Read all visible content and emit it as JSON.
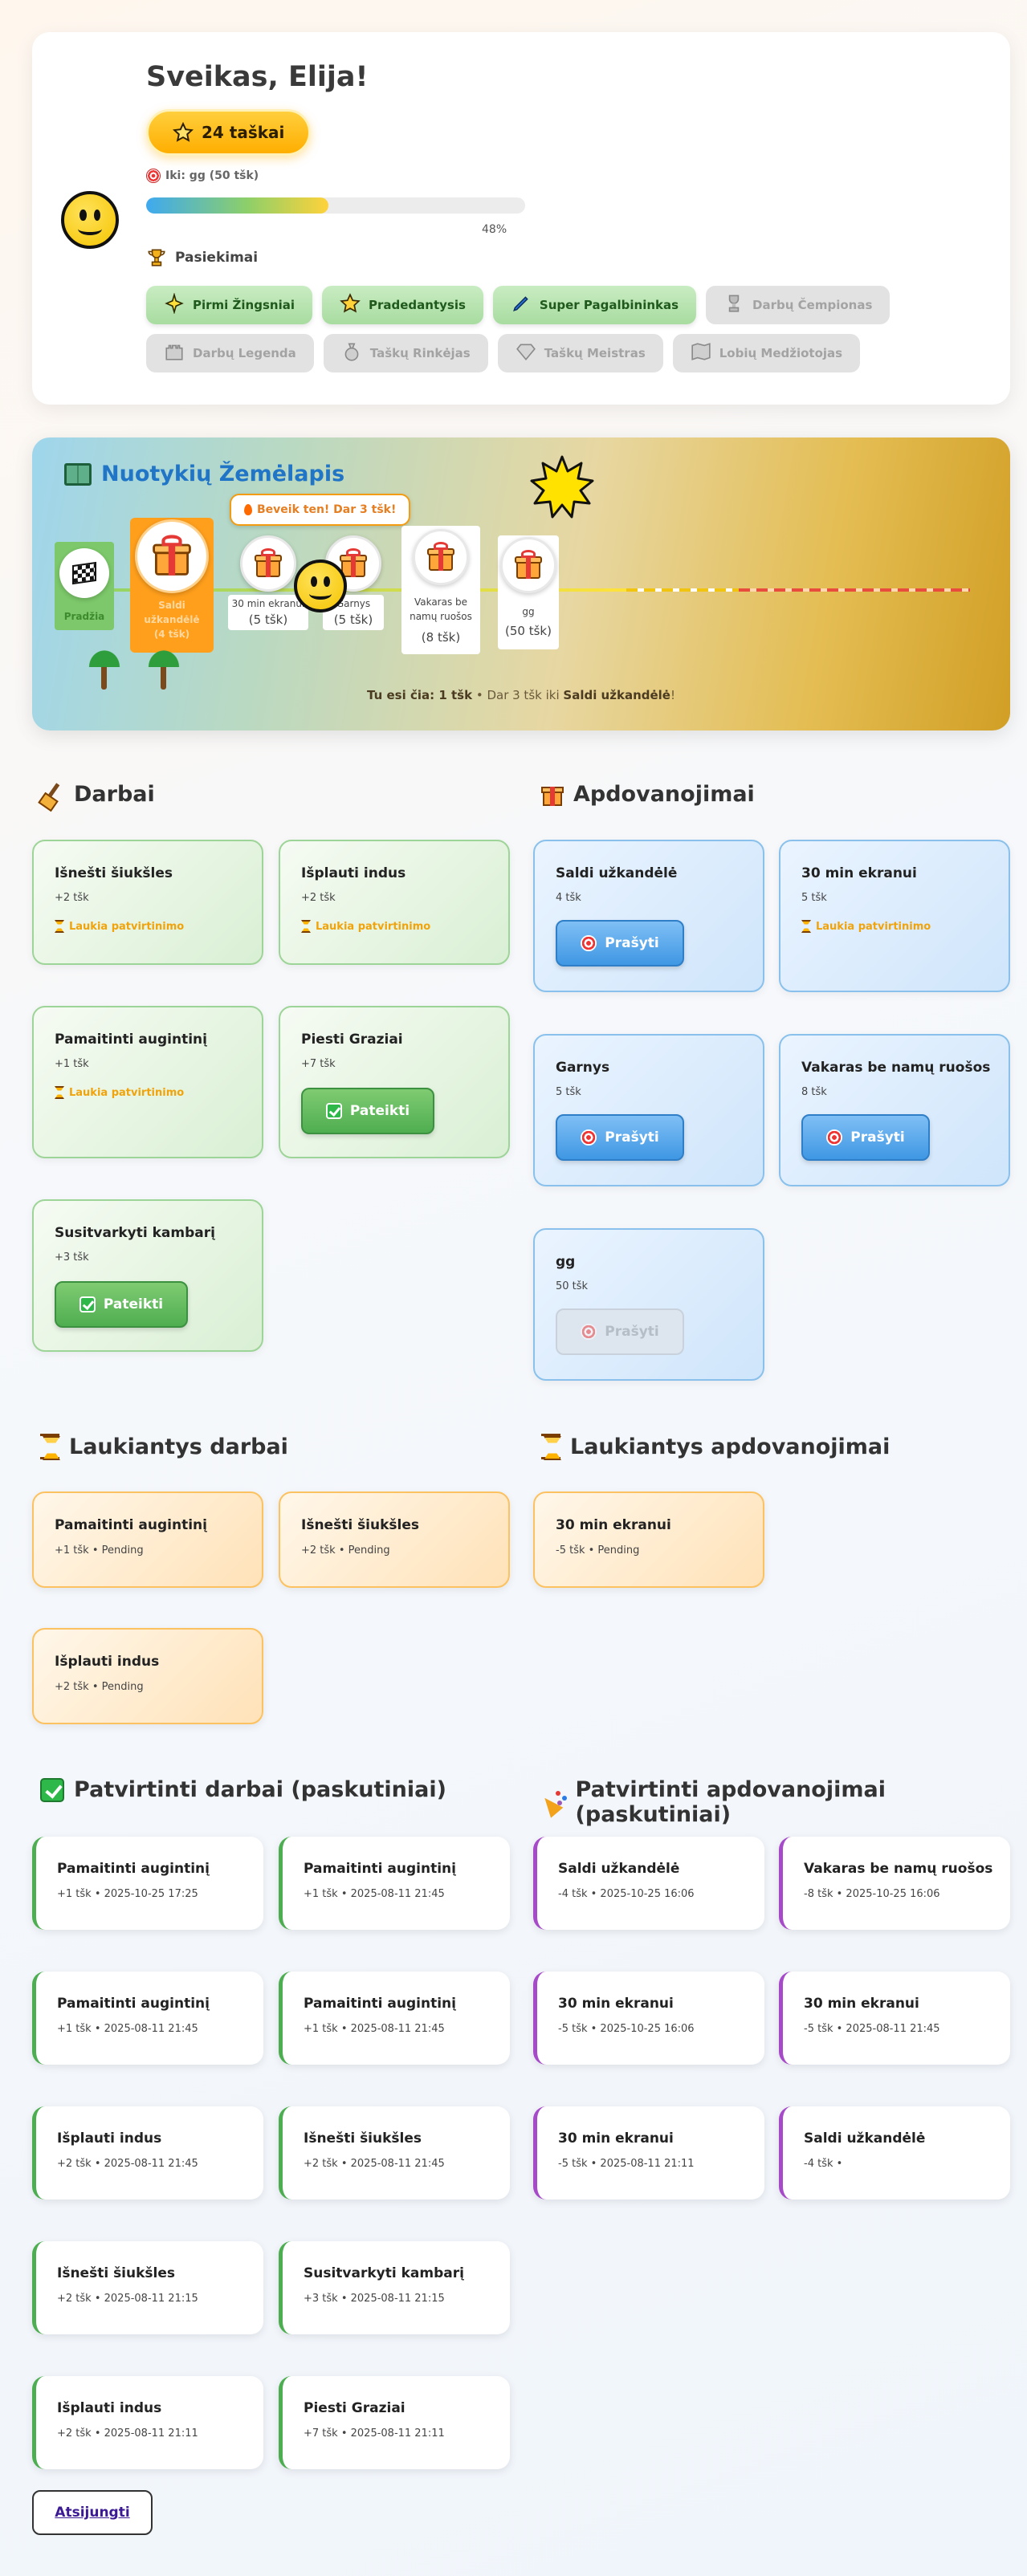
{
  "header": {
    "greeting": "Sveikas, Elija!",
    "points_label": "24 taškai",
    "goal_label": "Iki: gg (50 tšk)",
    "progress_percent": 48,
    "progress_label": "48%",
    "achievements_title": "Pasiekimai",
    "achievements": [
      {
        "label": "Pirmi Žingsniai",
        "unlocked": true,
        "icon": "sparkle-icon"
      },
      {
        "label": "Pradedantysis",
        "unlocked": true,
        "icon": "star-icon"
      },
      {
        "label": "Super Pagalbininkas",
        "unlocked": true,
        "icon": "brush-icon"
      },
      {
        "label": "Darbų Čempionas",
        "unlocked": false,
        "icon": "trophy-icon"
      },
      {
        "label": "Darbų Legenda",
        "unlocked": false,
        "icon": "castle-icon"
      },
      {
        "label": "Taškų Rinkėjas",
        "unlocked": false,
        "icon": "money-bag-icon"
      },
      {
        "label": "Taškų Meistras",
        "unlocked": false,
        "icon": "diamond-icon"
      },
      {
        "label": "Lobių Medžiotojas",
        "unlocked": false,
        "icon": "map-icon"
      }
    ]
  },
  "map": {
    "title": "Nuotykių Žemėlapis",
    "start_label": "Pradžia",
    "tip": "Beveik ten! Dar 3 tšk!",
    "nodes": [
      {
        "label": "Saldi užkandėlė",
        "points": "(4 tšk)",
        "current": true
      },
      {
        "label": "30 min ekranui",
        "points": "(5 tšk)"
      },
      {
        "label": "Garnys",
        "points": "(5 tšk)"
      },
      {
        "label": "Vakaras be namų ruošos",
        "points": "(8 tšk)"
      },
      {
        "label": "gg",
        "points": "(50 tšk)"
      }
    ],
    "footer_prefix": "Tu esi čia: 1 tšk",
    "footer_mid": " • Dar 3 tšk iki ",
    "footer_target": "Saldi užkandėlė",
    "footer_suffix": "!"
  },
  "tasks": {
    "title": "Darbai",
    "items": [
      {
        "title": "Išnešti šiukšles",
        "points": "+2 tšk",
        "status": "Laukia patvirtinimo"
      },
      {
        "title": "Išplauti indus",
        "points": "+2 tšk",
        "status": "Laukia patvirtinimo"
      },
      {
        "title": "Pamaitinti augintinį",
        "points": "+1 tšk",
        "status": "Laukia patvirtinimo"
      },
      {
        "title": "Piesti Graziai",
        "points": "+7 tšk",
        "button": "Pateikti"
      },
      {
        "title": "Susitvarkyti kambarį",
        "points": "+3 tšk",
        "button": "Pateikti"
      }
    ]
  },
  "rewards": {
    "title": "Apdovanojimai",
    "items": [
      {
        "title": "Saldi užkandėlė",
        "points": "4 tšk",
        "button": "Prašyti"
      },
      {
        "title": "30 min ekranui",
        "points": "5 tšk",
        "status": "Laukia patvirtinimo"
      },
      {
        "title": "Garnys",
        "points": "5 tšk",
        "button": "Prašyti"
      },
      {
        "title": "Vakaras be namų ruošos",
        "points": "8 tšk",
        "button": "Prašyti"
      },
      {
        "title": "gg",
        "points": "50 tšk",
        "button": "Prašyti",
        "disabled": true
      }
    ]
  },
  "pending_tasks": {
    "title": "Laukiantys darbai",
    "items": [
      {
        "title": "Pamaitinti augintinį",
        "sub": "+1 tšk • Pending"
      },
      {
        "title": "Išnešti šiukšles",
        "sub": "+2 tšk • Pending"
      },
      {
        "title": "Išplauti indus",
        "sub": "+2 tšk • Pending"
      }
    ]
  },
  "pending_rewards": {
    "title": "Laukiantys apdovanojimai",
    "items": [
      {
        "title": "30 min ekranui",
        "sub": "-5 tšk • Pending"
      }
    ]
  },
  "approved_tasks": {
    "title": "Patvirtinti darbai (paskutiniai)",
    "items": [
      {
        "title": "Pamaitinti augintinį",
        "sub": "+1 tšk • 2025-10-25 17:25"
      },
      {
        "title": "Pamaitinti augintinį",
        "sub": "+1 tšk • 2025-08-11 21:45"
      },
      {
        "title": "Pamaitinti augintinį",
        "sub": "+1 tšk • 2025-08-11 21:45"
      },
      {
        "title": "Pamaitinti augintinį",
        "sub": "+1 tšk • 2025-08-11 21:45"
      },
      {
        "title": "Išplauti indus",
        "sub": "+2 tšk • 2025-08-11 21:45"
      },
      {
        "title": "Išnešti šiukšles",
        "sub": "+2 tšk • 2025-08-11 21:45"
      },
      {
        "title": "Išnešti šiukšles",
        "sub": "+2 tšk • 2025-08-11 21:15"
      },
      {
        "title": "Susitvarkyti kambarį",
        "sub": "+3 tšk • 2025-08-11 21:15"
      },
      {
        "title": "Išplauti indus",
        "sub": "+2 tšk • 2025-08-11 21:11"
      },
      {
        "title": "Piesti Graziai",
        "sub": "+7 tšk • 2025-08-11 21:11"
      }
    ]
  },
  "approved_rewards": {
    "title": "Patvirtinti apdovanojimai (paskutiniai)",
    "items": [
      {
        "title": "Saldi užkandėlė",
        "sub": "-4 tšk • 2025-10-25 16:06"
      },
      {
        "title": "Vakaras be namų ruošos",
        "sub": "-8 tšk • 2025-10-25 16:06"
      },
      {
        "title": "30 min ekranui",
        "sub": "-5 tšk • 2025-10-25 16:06"
      },
      {
        "title": "30 min ekranui",
        "sub": "-5 tšk • 2025-08-11 21:45"
      },
      {
        "title": "30 min ekranui",
        "sub": "-5 tšk • 2025-08-11 21:11"
      },
      {
        "title": "Saldi užkandėlė",
        "sub": "-4 tšk •"
      }
    ]
  },
  "logout_label": "Atsijungti",
  "colors": {
    "accent_green": "#4fae50",
    "accent_blue": "#3f97e3",
    "accent_orange": "#ffae00",
    "reward_border": "#a64ac9"
  }
}
